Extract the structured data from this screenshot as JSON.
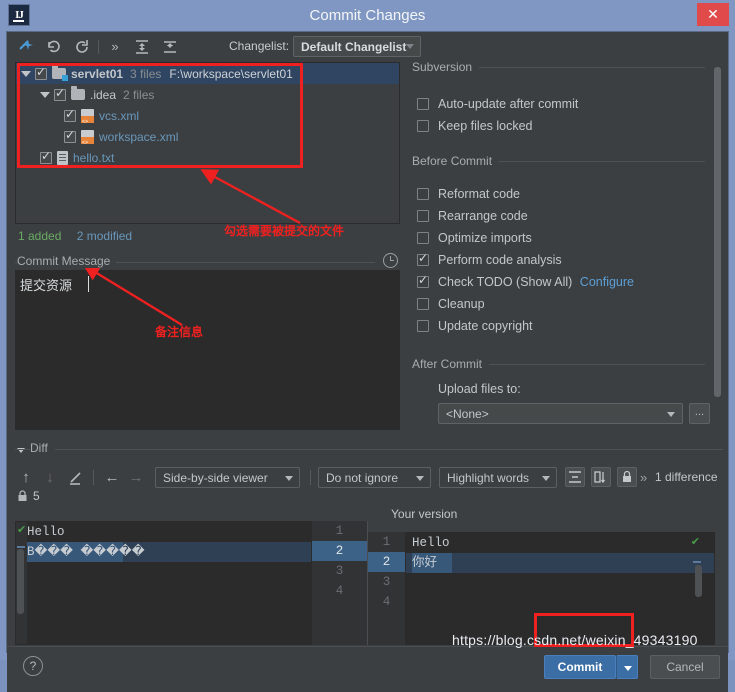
{
  "window": {
    "title": "Commit Changes",
    "app_icon": "intellij-idea-icon",
    "close_label": "✕"
  },
  "toolbar": {
    "icons": [
      {
        "name": "new-changelist-icon",
        "glyph": "✛"
      },
      {
        "name": "rollback-icon",
        "glyph": "↺"
      },
      {
        "name": "refresh-icon",
        "glyph": "⟳"
      },
      {
        "name": "more-icon",
        "glyph": "»"
      },
      {
        "name": "expand-all-icon",
        "glyph": "⤒"
      },
      {
        "name": "collapse-all-icon",
        "glyph": "⤓"
      }
    ],
    "changelist_label": "Changelist:",
    "changelist_value": "Default Changelist"
  },
  "tree": {
    "rows": [
      {
        "name": "servlet01",
        "meta": "3 files",
        "path": "F:\\workspace\\servlet01",
        "checked": true,
        "expanded": true,
        "kind": "folder",
        "indent": 0,
        "selected": true,
        "status": "plain"
      },
      {
        "name": ".idea",
        "meta": "2 files",
        "path": "",
        "checked": true,
        "expanded": true,
        "kind": "folder",
        "indent": 1,
        "selected": false,
        "status": "plain"
      },
      {
        "name": "vcs.xml",
        "meta": "",
        "path": "",
        "checked": true,
        "expanded": false,
        "kind": "xml",
        "indent": 2,
        "selected": false,
        "status": "modified"
      },
      {
        "name": "workspace.xml",
        "meta": "",
        "path": "",
        "checked": true,
        "expanded": false,
        "kind": "xml",
        "indent": 2,
        "selected": false,
        "status": "modified"
      },
      {
        "name": "hello.txt",
        "meta": "",
        "path": "",
        "checked": true,
        "expanded": false,
        "kind": "txt",
        "indent": 1,
        "selected": false,
        "status": "modified"
      }
    ]
  },
  "status": {
    "added": "1 added",
    "modified": "2 modified"
  },
  "commit_message": {
    "label": "Commit Message",
    "value": "提交资源",
    "history_icon": "clock-icon"
  },
  "subversion": {
    "title": "Subversion",
    "options": [
      {
        "label": "Auto-update after commit",
        "checked": false
      },
      {
        "label": "Keep files locked",
        "checked": false
      }
    ]
  },
  "before_commit": {
    "title": "Before Commit",
    "options": [
      {
        "label": "Reformat code",
        "checked": false,
        "link": ""
      },
      {
        "label": "Rearrange code",
        "checked": false,
        "link": ""
      },
      {
        "label": "Optimize imports",
        "checked": false,
        "link": ""
      },
      {
        "label": "Perform code analysis",
        "checked": true,
        "link": ""
      },
      {
        "label": "Check TODO (Show All)",
        "checked": true,
        "link": "Configure"
      },
      {
        "label": "Cleanup",
        "checked": false,
        "link": ""
      },
      {
        "label": "Update copyright",
        "checked": false,
        "link": ""
      }
    ]
  },
  "after_commit": {
    "title": "After Commit",
    "upload_label": "Upload files to:",
    "upload_value": "<None>",
    "browse_label": "..."
  },
  "diff": {
    "section_label": "Diff",
    "toolbar": {
      "prev_diff_icon": "arrow-up-icon",
      "next_diff_icon": "arrow-down-icon",
      "edit_icon": "pencil-icon",
      "apply_left_icon": "arrow-left-icon",
      "apply_right_icon": "arrow-right-icon",
      "viewer_mode": "Side-by-side viewer",
      "ignore_mode": "Do not ignore",
      "highlight_mode": "Highlight words",
      "collapse_unchanged_icon": "collapse-lines-icon",
      "align_icon": "align-columns-icon",
      "readonly_icon": "lock-icon",
      "more_icon": "»",
      "difference_count": "1 difference",
      "lock_icon": "lock-icon",
      "lock_count": "5"
    },
    "right_header": "Your version",
    "left_lines": [
      "Hello",
      "B��� �����"
    ],
    "left_numbers": [
      "1",
      "2",
      "3",
      "4"
    ],
    "right_numbers": [
      "1",
      "2",
      "3",
      "4"
    ],
    "right_lines": [
      "Hello",
      "你好"
    ],
    "changed_line_index": 1
  },
  "bottom": {
    "help_label": "?",
    "commit_label": "Commit",
    "cancel_label": "Cancel"
  },
  "annotations": {
    "tree_note": "勾选需要被提交的文件",
    "message_note": "备注信息"
  },
  "watermark": "https://blog.csdn.net/weixin_49343190",
  "colors": {
    "accent": "#3b6ea5",
    "added": "#6aaa64",
    "modified": "#6897bb",
    "link": "#5c9fd6",
    "annotation": "#ef2020",
    "titlebar": "#7f97c2",
    "panel": "#3c3f41",
    "editor": "#2b2b2b"
  }
}
